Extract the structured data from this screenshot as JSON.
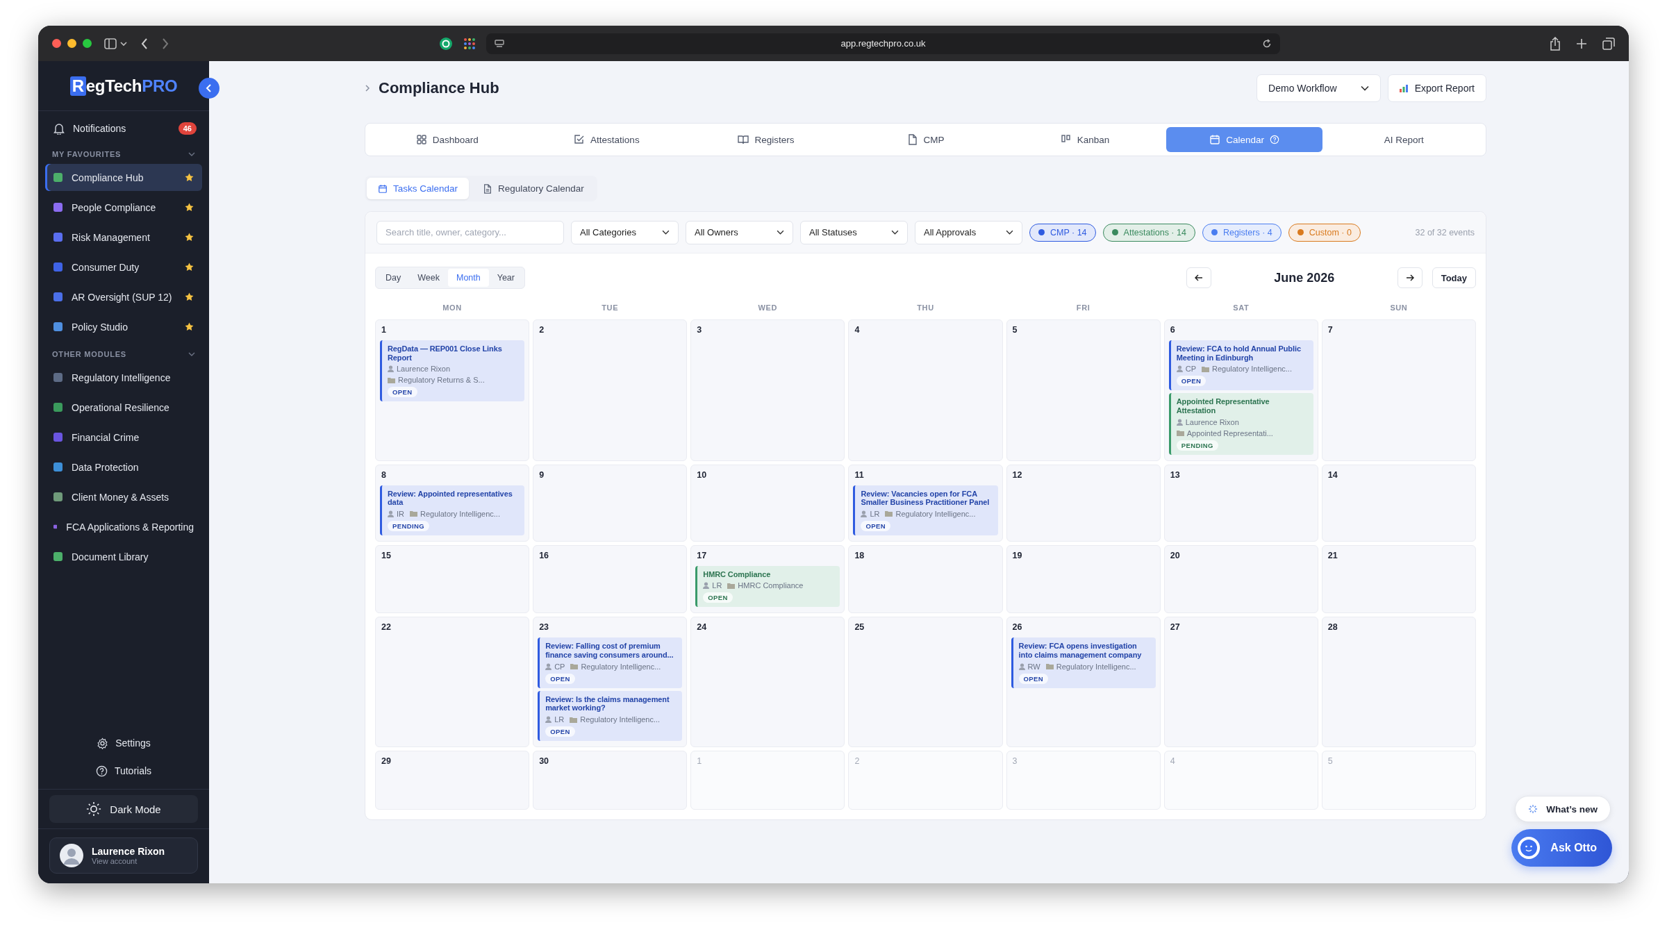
{
  "browser": {
    "url": "app.regtechpro.co.uk"
  },
  "sidebar": {
    "logo": [
      {
        "text": "R",
        "kind": "boxed"
      },
      {
        "text": "egTech",
        "kind": "plain"
      },
      {
        "text": "PRO",
        "kind": "accent"
      }
    ],
    "notifications": {
      "label": "Notifications",
      "count": "46"
    },
    "sections": [
      {
        "title": "MY FAVOURITES",
        "expanded": true,
        "items": [
          {
            "label": "Compliance Hub",
            "selected": true,
            "starred": true,
            "color": "#4caf6a"
          },
          {
            "label": "People Compliance",
            "selected": false,
            "starred": true,
            "color": "#8b6cf0"
          },
          {
            "label": "Risk Management",
            "selected": false,
            "starred": true,
            "color": "#5a6ef0"
          },
          {
            "label": "Consumer Duty",
            "selected": false,
            "starred": true,
            "color": "#3f63e6"
          },
          {
            "label": "AR Oversight (SUP 12)",
            "selected": false,
            "starred": true,
            "color": "#4b6fe8"
          },
          {
            "label": "Policy Studio",
            "selected": false,
            "starred": true,
            "color": "#4f8fe0"
          }
        ]
      },
      {
        "title": "OTHER MODULES",
        "expanded": true,
        "items": [
          {
            "label": "Regulatory Intelligence",
            "selected": false,
            "starred": false,
            "color": "#5d6b85"
          },
          {
            "label": "Operational Resilience",
            "selected": false,
            "starred": false,
            "color": "#3a9a5c"
          },
          {
            "label": "Financial Crime",
            "selected": false,
            "starred": false,
            "color": "#6a55e0"
          },
          {
            "label": "Data Protection",
            "selected": false,
            "starred": false,
            "color": "#3d8fd8"
          },
          {
            "label": "Client Money & Assets",
            "selected": false,
            "starred": false,
            "color": "#6f9a7a"
          },
          {
            "label": "FCA Applications & Reporting",
            "selected": false,
            "starred": false,
            "color": "#8a62e0"
          },
          {
            "label": "Document Library",
            "selected": false,
            "starred": false,
            "color": "#4caf6a"
          }
        ]
      }
    ],
    "footer_links": [
      {
        "label": "Settings"
      },
      {
        "label": "Tutorials"
      }
    ],
    "dark_mode": {
      "label": "Dark Mode"
    },
    "user": {
      "name": "Laurence Rixon",
      "subtitle": "View account"
    }
  },
  "header": {
    "title": "Compliance Hub",
    "workflow": "Demo Workflow",
    "export": "Export Report"
  },
  "tabs": [
    {
      "label": "Dashboard",
      "selected": false
    },
    {
      "label": "Attestations",
      "selected": false
    },
    {
      "label": "Registers",
      "selected": false
    },
    {
      "label": "CMP",
      "selected": false
    },
    {
      "label": "Kanban",
      "selected": false
    },
    {
      "label": "Calendar",
      "selected": true
    },
    {
      "label": "AI Report",
      "selected": false
    }
  ],
  "subtabs": [
    {
      "label": "Tasks Calendar",
      "selected": true
    },
    {
      "label": "Regulatory Calendar",
      "selected": false
    }
  ],
  "filters": {
    "search": {
      "placeholder": "Search title, owner, category..."
    },
    "dropdowns": [
      "All Categories",
      "All Owners",
      "All Statuses",
      "All Approvals"
    ],
    "legend": [
      {
        "label": "CMP · 14",
        "color": "#2f5be0"
      },
      {
        "label": "Attestations · 14",
        "color": "#3a8a5e"
      },
      {
        "label": "Registers · 4",
        "color": "#4a7df0"
      },
      {
        "label": "Custom · 0",
        "color": "#d97a1e"
      }
    ],
    "count": "32 of 32 events"
  },
  "views": [
    {
      "label": "Day",
      "selected": false
    },
    {
      "label": "Week",
      "selected": false
    },
    {
      "label": "Month",
      "selected": true
    },
    {
      "label": "Year",
      "selected": false
    }
  ],
  "month": "June 2026",
  "today": "Today",
  "weekdays": [
    "MON",
    "TUE",
    "WED",
    "THU",
    "FRI",
    "SAT",
    "SUN"
  ],
  "weeks": [
    [
      {
        "day": "1",
        "outside": false,
        "events": [
          {
            "title": "RegData — REP001 Close Links Report",
            "owner": "Laurence Rixon",
            "category": "Regulatory Returns & S...",
            "status": "OPEN",
            "color": "#2f5be0"
          }
        ]
      },
      {
        "day": "2",
        "outside": false
      },
      {
        "day": "3",
        "outside": false
      },
      {
        "day": "4",
        "outside": false
      },
      {
        "day": "5",
        "outside": false
      },
      {
        "day": "6",
        "outside": false,
        "events": [
          {
            "title": "Review: FCA to hold Annual Public Meeting in Edinburgh",
            "owner": "CP",
            "category": "Regulatory Intelligenc...",
            "status": "OPEN",
            "color": "#2f5be0"
          },
          {
            "title": "Appointed Representative Attestation",
            "owner": "Laurence Rixon",
            "category": "Appointed Representati...",
            "status": "PENDING",
            "color": "#3a9a6a"
          }
        ]
      },
      {
        "day": "7",
        "outside": false
      }
    ],
    [
      {
        "day": "8",
        "outside": false,
        "events": [
          {
            "title": "Review: Appointed representatives data",
            "owner": "IR",
            "category": "Regulatory Intelligenc...",
            "status": "PENDING",
            "color": "#2f5be0"
          }
        ]
      },
      {
        "day": "9",
        "outside": false
      },
      {
        "day": "10",
        "outside": false
      },
      {
        "day": "11",
        "outside": false,
        "events": [
          {
            "title": "Review: Vacancies open for FCA Smaller Business Practitioner Panel",
            "owner": "LR",
            "category": "Regulatory Intelligenc...",
            "status": "OPEN",
            "color": "#2f5be0"
          }
        ]
      },
      {
        "day": "12",
        "outside": false
      },
      {
        "day": "13",
        "outside": false
      },
      {
        "day": "14",
        "outside": false
      }
    ],
    [
      {
        "day": "15",
        "outside": false
      },
      {
        "day": "16",
        "outside": false
      },
      {
        "day": "17",
        "outside": false,
        "events": [
          {
            "title": "HMRC Compliance",
            "owner": "LR",
            "category": "HMRC Compliance",
            "status": "OPEN",
            "color": "#3a9a6a"
          }
        ]
      },
      {
        "day": "18",
        "outside": false
      },
      {
        "day": "19",
        "outside": false
      },
      {
        "day": "20",
        "outside": false
      },
      {
        "day": "21",
        "outside": false
      }
    ],
    [
      {
        "day": "22",
        "outside": false
      },
      {
        "day": "23",
        "outside": false,
        "events": [
          {
            "title": "Review: Falling cost of premium finance saving consumers around...",
            "owner": "CP",
            "category": "Regulatory Intelligenc...",
            "status": "OPEN",
            "color": "#2f5be0"
          },
          {
            "title": "Review: Is the claims management market working?",
            "owner": "LR",
            "category": "Regulatory Intelligenc...",
            "status": "OPEN",
            "color": "#2f5be0"
          }
        ]
      },
      {
        "day": "24",
        "outside": false
      },
      {
        "day": "25",
        "outside": false
      },
      {
        "day": "26",
        "outside": false,
        "events": [
          {
            "title": "Review: FCA opens investigation into claims management company",
            "owner": "RW",
            "category": "Regulatory Intelligenc...",
            "status": "OPEN",
            "color": "#2f5be0"
          }
        ]
      },
      {
        "day": "27",
        "outside": false
      },
      {
        "day": "28",
        "outside": false
      }
    ],
    [
      {
        "day": "29",
        "outside": false
      },
      {
        "day": "30",
        "outside": false
      },
      {
        "day": "1",
        "outside": true
      },
      {
        "day": "2",
        "outside": true
      },
      {
        "day": "3",
        "outside": true
      },
      {
        "day": "4",
        "outside": true
      },
      {
        "day": "5",
        "outside": true
      }
    ]
  ],
  "floating": {
    "whats_new": "What’s new",
    "assistant": "Ask Otto"
  }
}
